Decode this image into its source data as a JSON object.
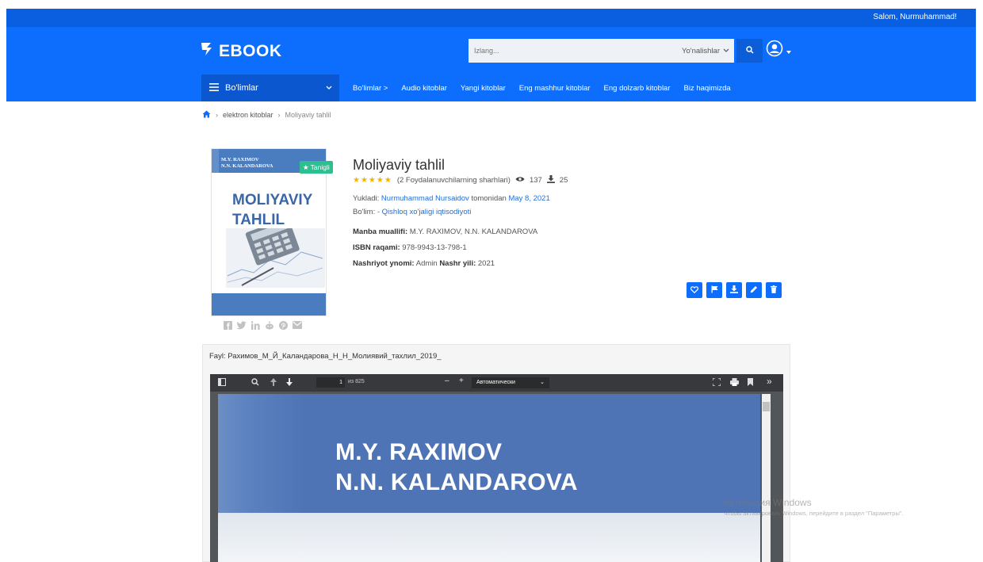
{
  "topbar": {
    "greeting": "Salom, Nurmuhammad!"
  },
  "header": {
    "logo": "EBOOK",
    "search_placeholder": "Izlang...",
    "search_select": "Yo'nalishlar"
  },
  "nav": {
    "departments_label": "Bo'limlar",
    "links": [
      "Bo'limlar >",
      "Audio kitoblar",
      "Yangi kitoblar",
      "Eng mashhur kitoblar",
      "Eng dolzarb kitoblar",
      "Biz haqimizda"
    ]
  },
  "breadcrumb": {
    "item1": "elektron kitoblar",
    "item2": "Moliyaviy tahlil"
  },
  "cover": {
    "author1": "M.Y. RAXIMOV",
    "author2": "N.N. KALANDAROVA",
    "title1": "MOLIYAVIY",
    "title2": "TAHLIL",
    "badge": "Tanigli"
  },
  "book": {
    "title": "Moliyaviy tahlil",
    "rating": 5,
    "reviews": "(2 Foydalanuvchilarning sharhlari)",
    "views": "137",
    "downloads": "25",
    "uploaded_prefix": "Yukladi:",
    "uploader": "Nurmuhammad Nursaidov",
    "uploaded_mid": "tomonidan",
    "date": "May 8, 2021",
    "section_label": "Bo'lim:",
    "section": "- Qishloq xo'jaligi iqtisodiyoti",
    "author_label": "Manba muallifi:",
    "author": "M.Y. RAXIMOV, N.N. KALANDAROVA",
    "isbn_label": "ISBN raqami:",
    "isbn": "978-9943-13-798-1",
    "publisher_label": "Nashriyot ynomi:",
    "publisher": "Admin",
    "year_label": "Nashr yili:",
    "year": "2021"
  },
  "file": {
    "label": "Fayl: Рахимов_М_Й_Каландарова_Н_Н_Молиявий_тахлил_2019_",
    "page_current": "1",
    "page_total": "из 825",
    "zoom": "Автоматически",
    "page_author1": "M.Y. RAXIMOV",
    "page_author2": "N.N. KALANDAROVA"
  },
  "watermark": {
    "line1": "Активация Windows",
    "line2": "Чтобы активировать Windows, перейдите в раздел \"Параметры\"."
  },
  "colors": {
    "primary": "#0d6efd",
    "topbar": "#0a5fe0",
    "badge": "#2ebf91",
    "star": "#f0b400"
  }
}
